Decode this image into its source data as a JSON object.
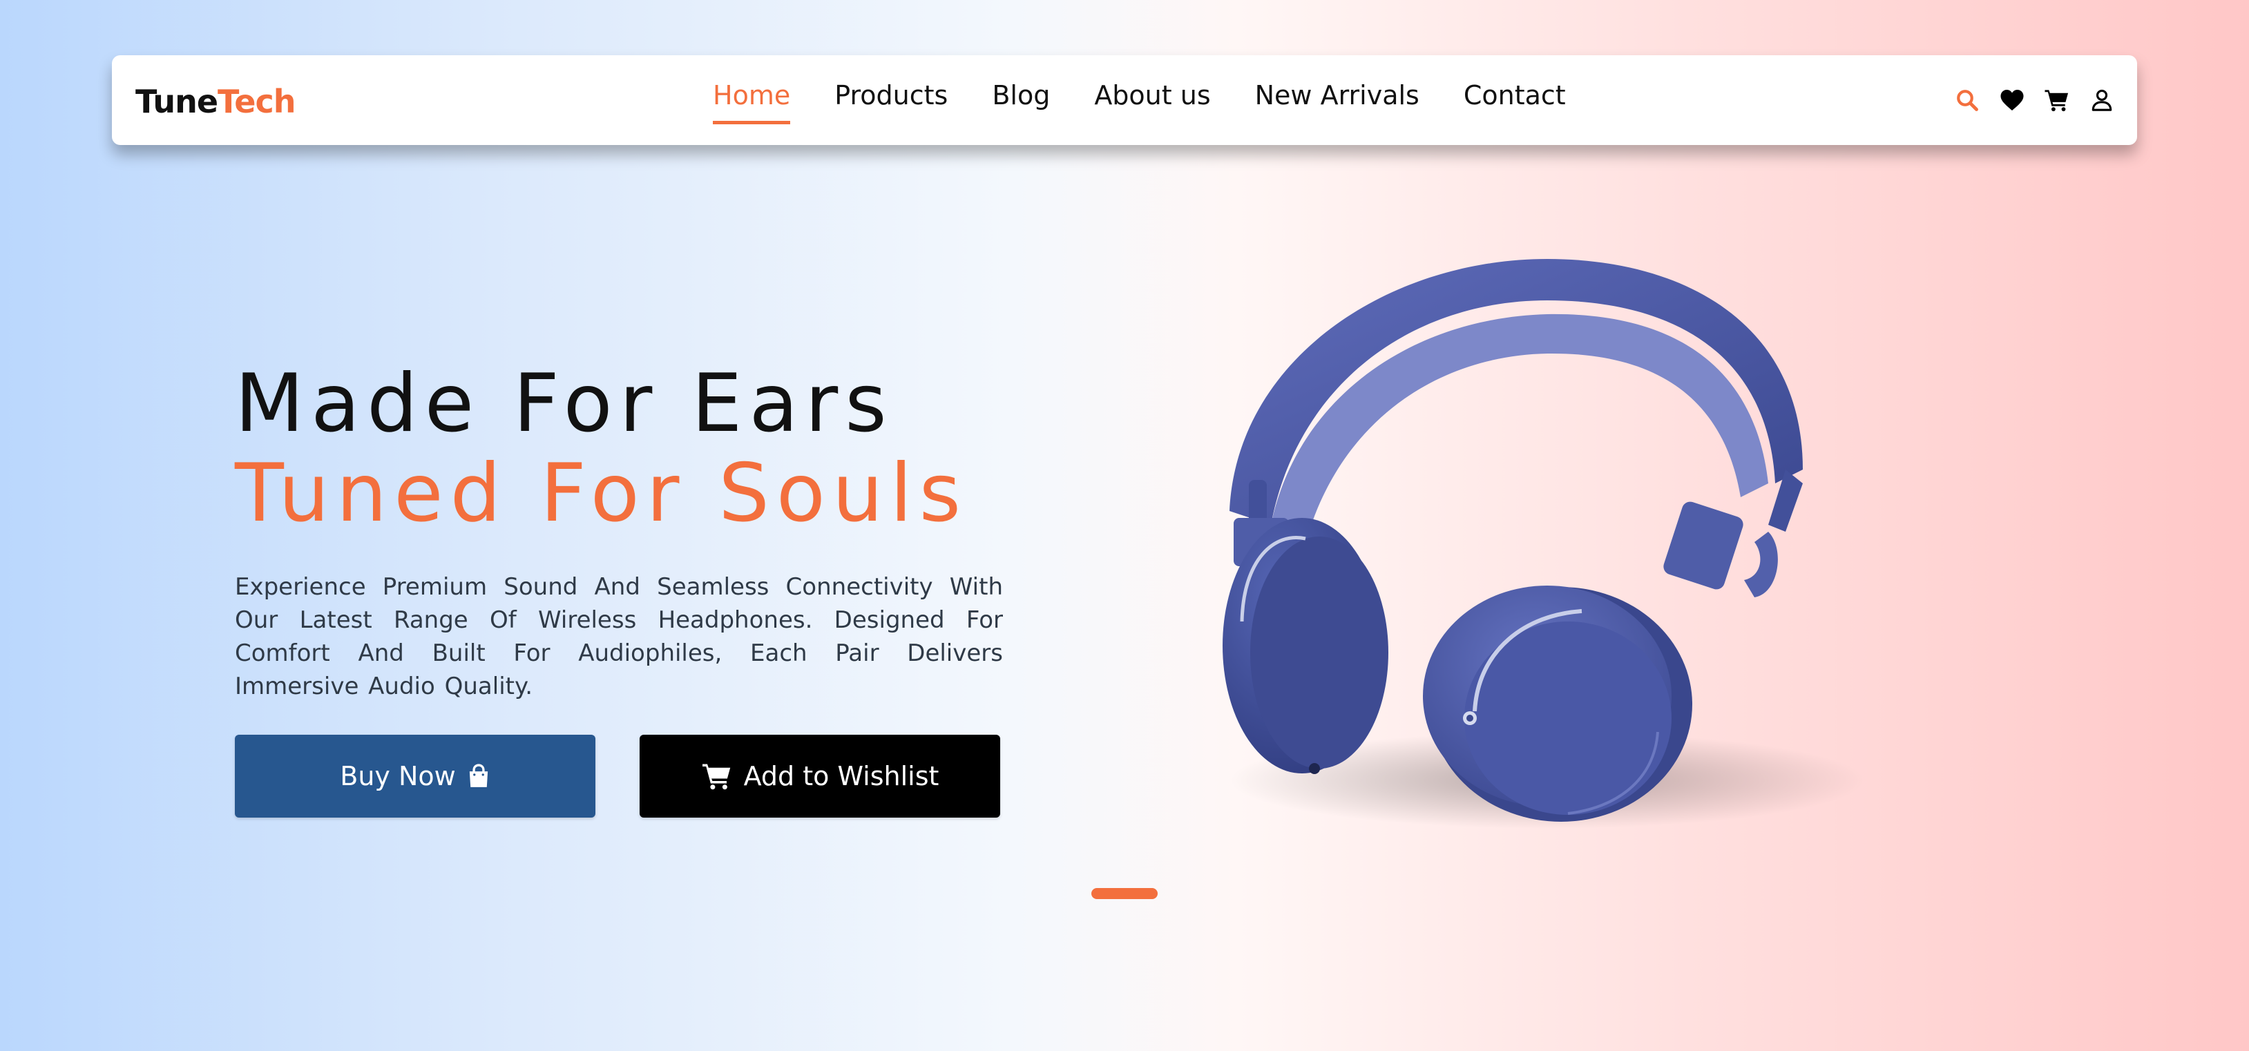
{
  "brand": {
    "part1": "Tune",
    "part2": "Tech"
  },
  "nav": {
    "items": [
      {
        "label": "Home",
        "active": true
      },
      {
        "label": "Products",
        "active": false
      },
      {
        "label": "Blog",
        "active": false
      },
      {
        "label": "About us",
        "active": false
      },
      {
        "label": "New Arrivals",
        "active": false
      },
      {
        "label": "Contact",
        "active": false
      }
    ],
    "icons": [
      "search-icon",
      "heart-icon",
      "cart-icon",
      "user-icon"
    ]
  },
  "hero": {
    "headline_line1": "Made For Ears",
    "headline_line2": "Tuned For Souls",
    "description": "Experience Premium Sound And Seamless Connectivity With Our Latest Range Of Wireless Headphones. Designed For Comfort And Built For Audiophiles, Each Pair Delivers Immersive Audio Quality.",
    "buy_button": "Buy Now",
    "wishlist_button": "Add to Wishlist"
  },
  "product": {
    "image": "blue-wireless-headphones"
  },
  "slider": {
    "active_index": 1,
    "total": 1
  },
  "colors": {
    "accent": "#f36f3d",
    "buy_button": "#27578f",
    "wishlist_button": "#000000",
    "headphone": "#4a58a4",
    "bg_left": "#bad7fd",
    "bg_right": "#ffc7c7"
  }
}
